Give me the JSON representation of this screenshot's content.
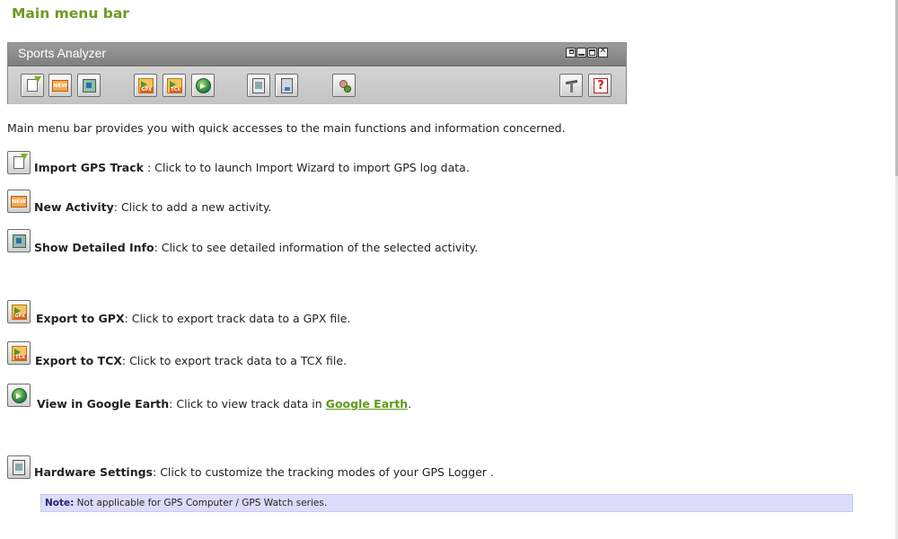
{
  "page": {
    "title": "Main menu bar",
    "intro": "Main menu bar provides you with quick accesses to the main functions and information concerned."
  },
  "app": {
    "window_title": "Sports Analyzer",
    "window_controls": [
      {
        "name": "restore-icon"
      },
      {
        "name": "minimize-icon"
      },
      {
        "name": "maximize-icon"
      },
      {
        "name": "close-icon"
      }
    ],
    "toolbar": [
      {
        "name": "import-gps-track-button",
        "icon": "import-doc-arrow-icon"
      },
      {
        "name": "new-activity-button",
        "icon": "new-activity-icon",
        "glyph": "NEW"
      },
      {
        "name": "show-detailed-info-button",
        "icon": "detailed-info-icon"
      },
      {
        "name": "export-gpx-button",
        "icon": "export-gpx-icon",
        "glyph": "GPX"
      },
      {
        "name": "export-tcx-button",
        "icon": "export-tcx-icon",
        "glyph": "TCX"
      },
      {
        "name": "view-google-earth-button",
        "icon": "google-earth-icon"
      },
      {
        "name": "hardware-settings-button",
        "icon": "hardware-settings-icon"
      },
      {
        "name": "memory-button",
        "icon": "memory-icon"
      },
      {
        "name": "user-profile-button",
        "icon": "user-profile-icon"
      },
      {
        "name": "tools-button",
        "icon": "tools-icon"
      },
      {
        "name": "help-button",
        "icon": "help-icon",
        "glyph": "?"
      }
    ]
  },
  "items": [
    {
      "label": "Import GPS Track",
      "sep": " : ",
      "desc": "Click to to launch Import Wizard to import GPS log data."
    },
    {
      "label": "New Activity",
      "sep": ": ",
      "desc": "Click to add a new activity."
    },
    {
      "label": "Show Detailed Info",
      "sep": ": ",
      "desc": "Click to see detailed information of the selected activity."
    },
    {
      "label": "Export to GPX",
      "sep": ": ",
      "desc": "Click to export track data to a GPX file."
    },
    {
      "label": "Export to TCX",
      "sep": ": ",
      "desc": "Click to export track data to a TCX file."
    },
    {
      "label": "View in Google Earth",
      "sep": ": ",
      "desc": "Click to view track data in ",
      "link": "Google Earth",
      "after": "."
    },
    {
      "label": "Hardware Settings",
      "sep": ": ",
      "desc": "Click to customize the tracking modes of your GPS Logger ."
    }
  ],
  "note": {
    "label": "Note:",
    "text": " Not applicable for GPS Computer / GPS Watch series."
  }
}
